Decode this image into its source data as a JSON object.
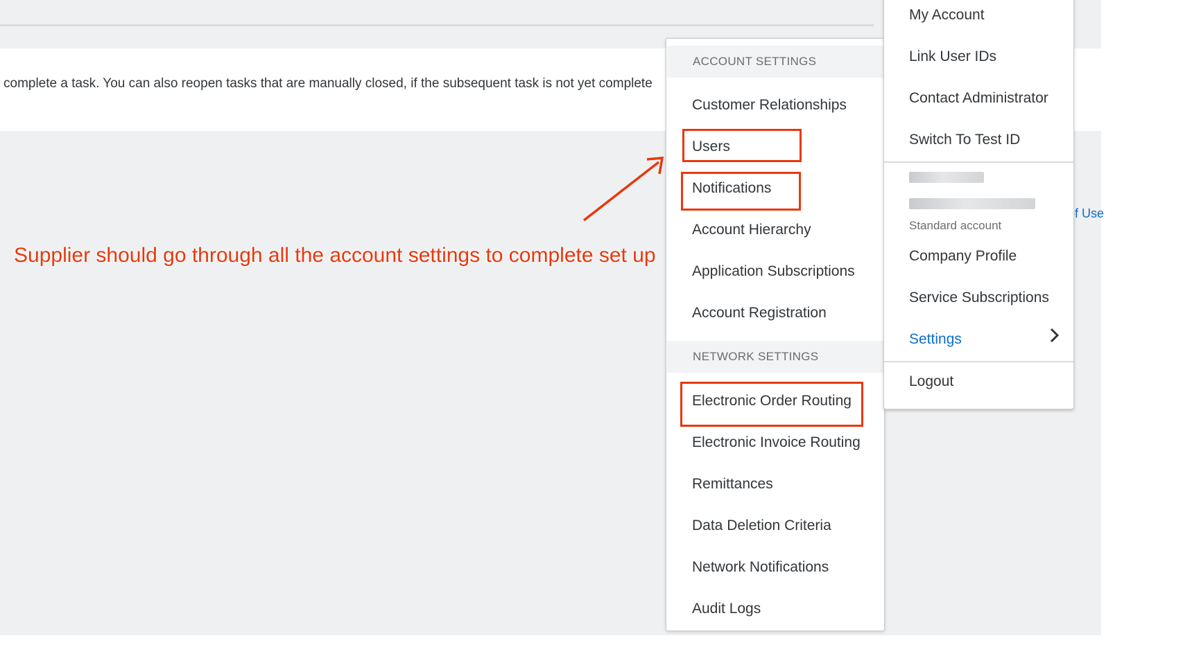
{
  "background": {
    "info_text": "complete a task. You can also reopen tasks that are manually closed, if the subsequent task is not yet complete",
    "side_link_fragment": "of Use"
  },
  "annotation": {
    "text": "Supplier should go through all the account settings to complete set up",
    "color": "#e8380d"
  },
  "settings_menu": {
    "account_header": "ACCOUNT SETTINGS",
    "account_items": [
      "Customer Relationships",
      "Users",
      "Notifications",
      "Account Hierarchy",
      "Application Subscriptions",
      "Account Registration"
    ],
    "network_header": "NETWORK SETTINGS",
    "network_items": [
      "Electronic Order Routing",
      "Electronic Invoice Routing",
      "Remittances",
      "Data Deletion Criteria",
      "Network Notifications",
      "Audit Logs"
    ],
    "highlighted": [
      "Users",
      "Notifications",
      "Electronic Order Routing"
    ]
  },
  "account_menu": {
    "items": [
      "My Account",
      "Link User IDs",
      "Contact Administrator",
      "Switch To Test ID"
    ],
    "account_type": "Standard account",
    "items2": [
      "Company Profile",
      "Service Subscriptions"
    ],
    "settings_label": "Settings",
    "logout_label": "Logout",
    "accent_color": "#0a6ed1"
  }
}
